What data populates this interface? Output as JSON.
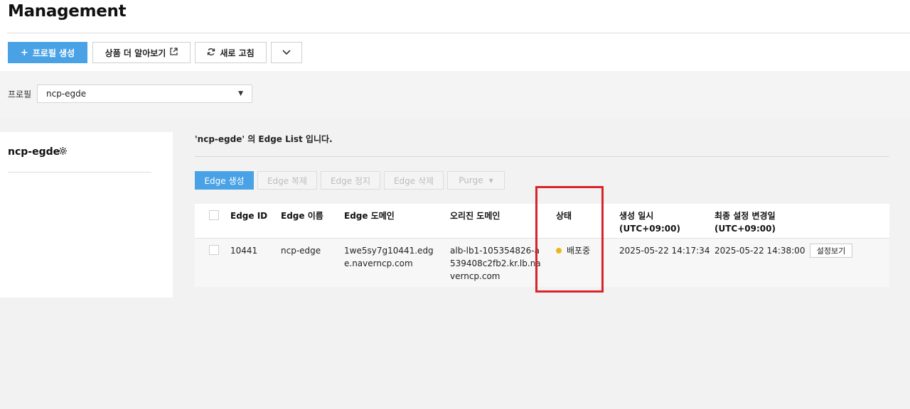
{
  "page": {
    "title": "Management"
  },
  "toolbar": {
    "create_profile": "프로필 생성",
    "learn_more": "상품 더 알아보기",
    "refresh": "새로 고침"
  },
  "filter": {
    "label": "프로필",
    "selected": "ncp-egde"
  },
  "sidebar": {
    "profile_name": "ncp-egde"
  },
  "edge_list": {
    "caption": "'ncp-egde' 의 Edge List 입니다.",
    "actions": [
      "Edge 생성",
      "Edge 복제",
      "Edge 정지",
      "Edge 삭제",
      "Purge"
    ],
    "columns": [
      "Edge ID",
      "Edge 이름",
      "Edge 도메인",
      "오리진 도메인",
      "상태",
      "생성 일시\n(UTC+09:00)",
      "최종 설정 변경일\n(UTC+09:00)"
    ],
    "rows": [
      {
        "id": "10441",
        "name": "ncp-edge",
        "domain": "1we5sy7g10441.edge.naverncp.com",
        "origin": "alb-lb1-105354826-a539408c2fb2.kr.lb.naverncp.com",
        "status": "배포중",
        "created": "2025-05-22 14:17:34",
        "modified": "2025-05-22 14:38:00",
        "view_label": "설정보기"
      }
    ]
  },
  "colors": {
    "primary": "#4aa2e6",
    "status_deploying": "#e8b81a",
    "highlight": "#d9232a"
  },
  "icons": [
    "plus-icon",
    "external-link-icon",
    "refresh-icon",
    "chevron-down-icon",
    "caret-down-icon",
    "gear-icon"
  ]
}
